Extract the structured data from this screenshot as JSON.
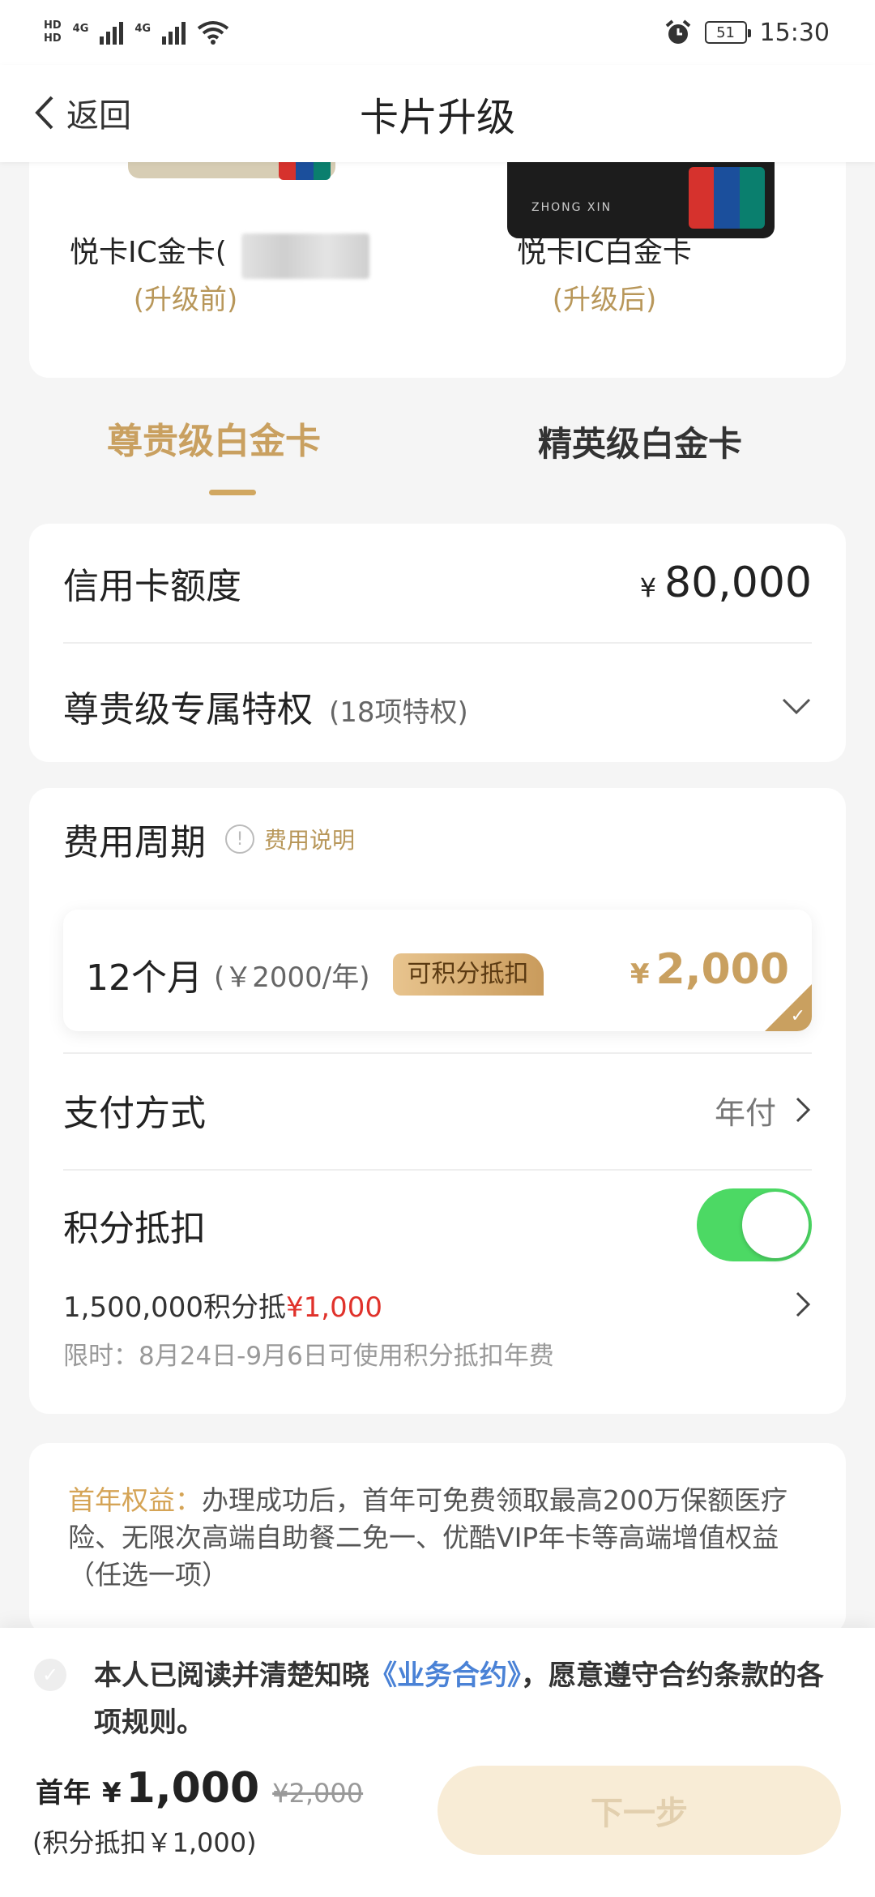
{
  "status_bar": {
    "time": "15:30",
    "battery": "51",
    "net1": "4G",
    "net2": "4G",
    "hd1": "HD",
    "hd2": "HD"
  },
  "nav": {
    "back_label": "返回",
    "title": "卡片升级"
  },
  "cards": {
    "before": {
      "name": "悦卡IC金卡(",
      "tag": "(升级前)"
    },
    "after": {
      "name": "悦卡IC白金卡",
      "tag": "(升级后)",
      "holder": "ZHONG XIN"
    }
  },
  "tabs": [
    {
      "label": "尊贵级白金卡",
      "active": true
    },
    {
      "label": "精英级白金卡",
      "active": false
    }
  ],
  "credit": {
    "label": "信用卡额度",
    "currency": "¥",
    "amount": "80,000"
  },
  "privilege": {
    "label": "尊贵级专属特权",
    "count": "(18项特权)"
  },
  "fee": {
    "label": "费用周期",
    "info_icon": "!",
    "explain_link": "费用说明",
    "period": "12个月",
    "period_rate": "(￥2000/年)",
    "badge": "可积分抵扣",
    "currency": "¥",
    "price": "2,000"
  },
  "payment": {
    "label": "支付方式",
    "value": "年付"
  },
  "points": {
    "label": "积分抵扣",
    "enabled": true,
    "detail_prefix": "1,500,000积分抵",
    "detail_amount": "¥1,000",
    "limit_note": "限时：8月24日-9月6日可使用积分抵扣年费"
  },
  "benefit": {
    "highlight": "首年权益：",
    "text": "办理成功后，首年可免费领取最高200万保额医疗险、无限次高端自助餐二免一、优酷VIP年卡等高端增值权益（任选一项）"
  },
  "agreement": {
    "prefix": "本人已阅读并清楚知晓",
    "link": "《业务合约》",
    "suffix": "，愿意遵守合约条款的各项规则。"
  },
  "summary": {
    "label": "首年",
    "currency": "¥",
    "amount": "1,000",
    "original": "¥2,000",
    "note": "(积分抵扣￥1,000)"
  },
  "next_button": "下一步",
  "colors": {
    "gold": "#c9a060",
    "toggle_on": "#4cd964",
    "link_blue": "#4a82d6",
    "red": "#e0322b"
  }
}
